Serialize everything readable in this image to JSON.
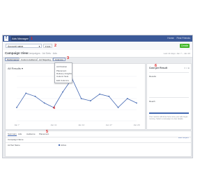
{
  "topbar": {
    "logo": "f",
    "app_name": "Ads Manager",
    "links": [
      "Home",
      "Find Friends"
    ]
  },
  "selector": {
    "account": "Account name",
    "secondary": "▾ Ads",
    "create": "Create Ad"
  },
  "header": {
    "title": "Campaign View",
    "subtitle": "Campaigns · Ad Sets · Ads",
    "date_range": "Last 14 days: Jan 7 – Jan 20"
  },
  "tabs": [
    "Performance",
    "Custom Audiences",
    "Ad Targeting",
    "Columns"
  ],
  "dropdown": {
    "items": [
      "Ad Position",
      "Placement",
      "Delivery Insights",
      "Column Sets",
      "Edit Columns"
    ]
  },
  "chart": {
    "title": "All Results ▾"
  },
  "side": {
    "title": "Cost per Result",
    "icons": "≡ × ⊕",
    "label_1": "Results",
    "label_2": "Reach",
    "note": "Your metrics will show here once your ads begin running. Select a campaign to view details."
  },
  "bottom": {
    "tabs": [
      "Summary",
      "Ads",
      "Audience",
      "Placement"
    ],
    "row_header": "Campaign Name",
    "row_value": "Ad Set Name",
    "row_status": "Active",
    "link": "Edit Report"
  },
  "annotations": [
    "1",
    "2",
    "3",
    "4",
    "5",
    "6"
  ],
  "chart_data": {
    "type": "line",
    "series": [
      {
        "values": [
          30,
          62,
          55,
          40,
          30,
          65,
          95,
          50,
          45,
          60,
          55,
          30,
          50,
          40
        ]
      }
    ],
    "x_tick_labels": [
      "Jan 7",
      "",
      "",
      "",
      "Jan 11",
      "",
      "",
      "Jan 14",
      "",
      "",
      "Jan 17",
      "",
      "",
      "Jan 20"
    ]
  }
}
